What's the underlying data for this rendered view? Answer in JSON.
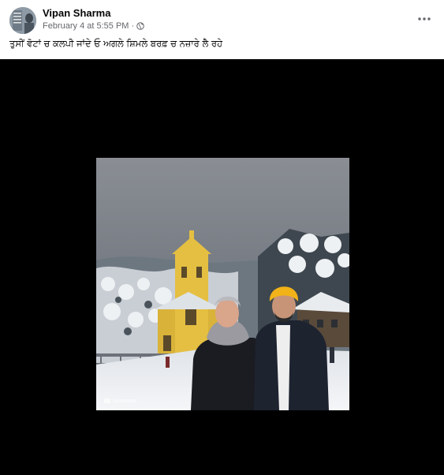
{
  "post": {
    "author": "Vipan Sharma",
    "timestamp": "February 4 at 5:55 PM",
    "separator": "·",
    "audience_icon": "globe-icon",
    "caption": "ਤੁਸੀਂ ਵੋਟਾਂ ਚ ਕਲਪੀ ਜਾਂਦੇ ਓ ਅਗਲੇ ਸ਼ਿਮਲੇ ਬਰਫ਼ ਚ ਨਜ਼ਾਰੇ ਲੈ ਰਹੇ",
    "more_icon": "more-options-icon"
  },
  "colors": {
    "media_background": "#000000",
    "author_text": "#050505",
    "meta_text": "#65676b"
  }
}
